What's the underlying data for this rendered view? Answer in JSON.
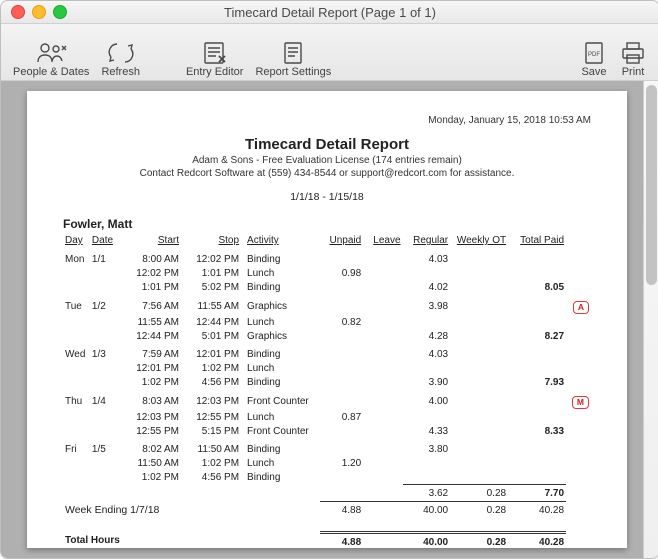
{
  "window_title": "Timecard Detail Report  (Page 1 of 1)",
  "toolbar": {
    "people": "People & Dates",
    "refresh": "Refresh",
    "editor": "Entry Editor",
    "settings": "Report Settings",
    "save": "Save",
    "print": "Print"
  },
  "report": {
    "timestamp": "Monday, January 15, 2018  10:53 AM",
    "title": "Timecard Detail Report",
    "license": "Adam & Sons - Free Evaluation License (174 entries remain)",
    "contact": "Contact Redcort Software at (559) 434-8544 or support@redcort.com for assistance.",
    "range": "1/1/18 - 1/15/18",
    "employee": "Fowler, Matt",
    "headers": {
      "day": "Day",
      "date": "Date",
      "start": "Start",
      "stop": "Stop",
      "activity": "Activity",
      "unpaid": "Unpaid",
      "leave": "Leave",
      "regular": "Regular",
      "weekly_ot": "Weekly OT",
      "total_paid": "Total Paid"
    },
    "rows": [
      {
        "g": 1,
        "day": "Mon",
        "date": "1/1",
        "start": "8:00 AM",
        "stop": "12:02 PM",
        "act": "Binding",
        "unpaid": "",
        "reg": "4.03",
        "tp": "",
        "badge": ""
      },
      {
        "g": 0,
        "day": "",
        "date": "",
        "start": "12:02 PM",
        "stop": "1:01 PM",
        "act": "Lunch",
        "unpaid": "0.98",
        "reg": "",
        "tp": "",
        "badge": ""
      },
      {
        "g": 0,
        "day": "",
        "date": "",
        "start": "1:01 PM",
        "stop": "5:02 PM",
        "act": "Binding",
        "unpaid": "",
        "reg": "4.02",
        "tp": "8.05",
        "badge": "",
        "b": 1
      },
      {
        "g": 1,
        "day": "Tue",
        "date": "1/2",
        "start": "7:56 AM",
        "stop": "11:55 AM",
        "act": "Graphics",
        "unpaid": "",
        "reg": "3.98",
        "tp": "",
        "badge": "A"
      },
      {
        "g": 0,
        "day": "",
        "date": "",
        "start": "11:55 AM",
        "stop": "12:44 PM",
        "act": "Lunch",
        "unpaid": "0.82",
        "reg": "",
        "tp": "",
        "badge": ""
      },
      {
        "g": 0,
        "day": "",
        "date": "",
        "start": "12:44 PM",
        "stop": "5:01 PM",
        "act": "Graphics",
        "unpaid": "",
        "reg": "4.28",
        "tp": "8.27",
        "badge": "",
        "b": 1
      },
      {
        "g": 1,
        "day": "Wed",
        "date": "1/3",
        "start": "7:59 AM",
        "stop": "12:01 PM",
        "act": "Binding",
        "unpaid": "",
        "reg": "4.03",
        "tp": "",
        "badge": ""
      },
      {
        "g": 0,
        "day": "",
        "date": "",
        "start": "12:01 PM",
        "stop": "1:02 PM",
        "act": "Lunch",
        "unpaid": "",
        "reg": "",
        "tp": "",
        "badge": ""
      },
      {
        "g": 0,
        "day": "",
        "date": "",
        "start": "1:02 PM",
        "stop": "4:56 PM",
        "act": "Binding",
        "unpaid": "",
        "reg": "3.90",
        "tp": "7.93",
        "badge": "",
        "b": 1
      },
      {
        "g": 1,
        "day": "Thu",
        "date": "1/4",
        "start": "8:03 AM",
        "stop": "12:03 PM",
        "act": "Front Counter",
        "unpaid": "",
        "reg": "4.00",
        "tp": "",
        "badge": "M"
      },
      {
        "g": 0,
        "day": "",
        "date": "",
        "start": "12:03 PM",
        "stop": "12:55 PM",
        "act": "Lunch",
        "unpaid": "0.87",
        "reg": "",
        "tp": "",
        "badge": ""
      },
      {
        "g": 0,
        "day": "",
        "date": "",
        "start": "12:55 PM",
        "stop": "5:15 PM",
        "act": "Front Counter",
        "unpaid": "",
        "reg": "4.33",
        "tp": "8.33",
        "badge": "",
        "b": 1
      },
      {
        "g": 1,
        "day": "Fri",
        "date": "1/5",
        "start": "8:02 AM",
        "stop": "11:50 AM",
        "act": "Binding",
        "unpaid": "",
        "reg": "3.80",
        "tp": "",
        "badge": ""
      },
      {
        "g": 0,
        "day": "",
        "date": "",
        "start": "11:50 AM",
        "stop": "1:02 PM",
        "act": "Lunch",
        "unpaid": "1.20",
        "reg": "",
        "tp": "",
        "badge": ""
      },
      {
        "g": 0,
        "day": "",
        "date": "",
        "start": "1:02 PM",
        "stop": "4:56 PM",
        "act": "Binding",
        "unpaid": "",
        "reg": "",
        "tp": "",
        "badge": ""
      }
    ],
    "fri_sum": {
      "reg": "3.62",
      "ot": "0.28",
      "tp": "7.70"
    },
    "week_ending_label": "Week Ending 1/7/18",
    "week_ending": {
      "unpaid": "4.88",
      "leave": "",
      "reg": "40.00",
      "ot": "0.28",
      "tp": "40.28"
    },
    "total_label": "Total Hours",
    "totals": {
      "unpaid": "4.88",
      "leave": "",
      "reg": "40.00",
      "ot": "0.28",
      "tp": "40.28"
    }
  }
}
